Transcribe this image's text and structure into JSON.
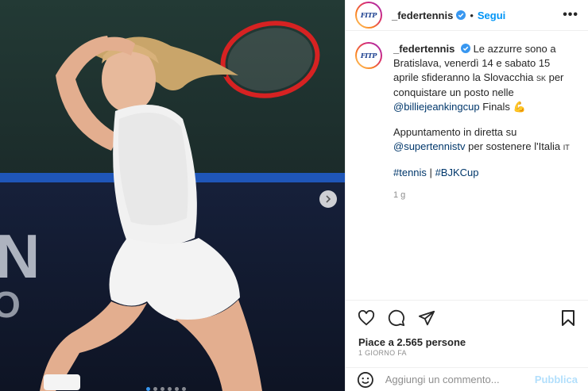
{
  "post": {
    "username": "_federtennis",
    "follow_label": "Segui",
    "more_label": "•••",
    "avatar_text": "FITP"
  },
  "caption": {
    "username": "_federtennis",
    "line1": "Le azzurre sono a Bratislava, venerdì 14 e sabato 15 aprile sfideranno la Slovacchia",
    "flag_sk": "SK",
    "line1b": "per conquistare un posto nelle",
    "mention1": "@billiejeankingcup",
    "line1c": "Finals",
    "emoji_muscle": "💪",
    "line2": "Appuntamento in diretta su",
    "mention2": "@supertennistv",
    "line2b": "per sostenere l'Italia",
    "flag_it": "IT",
    "hashtag1": "#tennis",
    "separator": "|",
    "hashtag2": "#BJKCup",
    "time": "1 g"
  },
  "engagement": {
    "likes": "Piace a 2.565 persone",
    "posted": "1 GIORNO FA"
  },
  "comment": {
    "placeholder": "Aggiungi un commento...",
    "publish_label": "Pubblica"
  },
  "icons": [
    "heart-icon",
    "comment-icon",
    "share-icon",
    "bookmark-icon",
    "emoji-icon",
    "verified-icon",
    "chevron-right-icon"
  ],
  "colors": {
    "accent": "#0095f6",
    "link": "#00376b",
    "muted": "#8e8e8e",
    "publish_disabled": "#b2dffc"
  }
}
